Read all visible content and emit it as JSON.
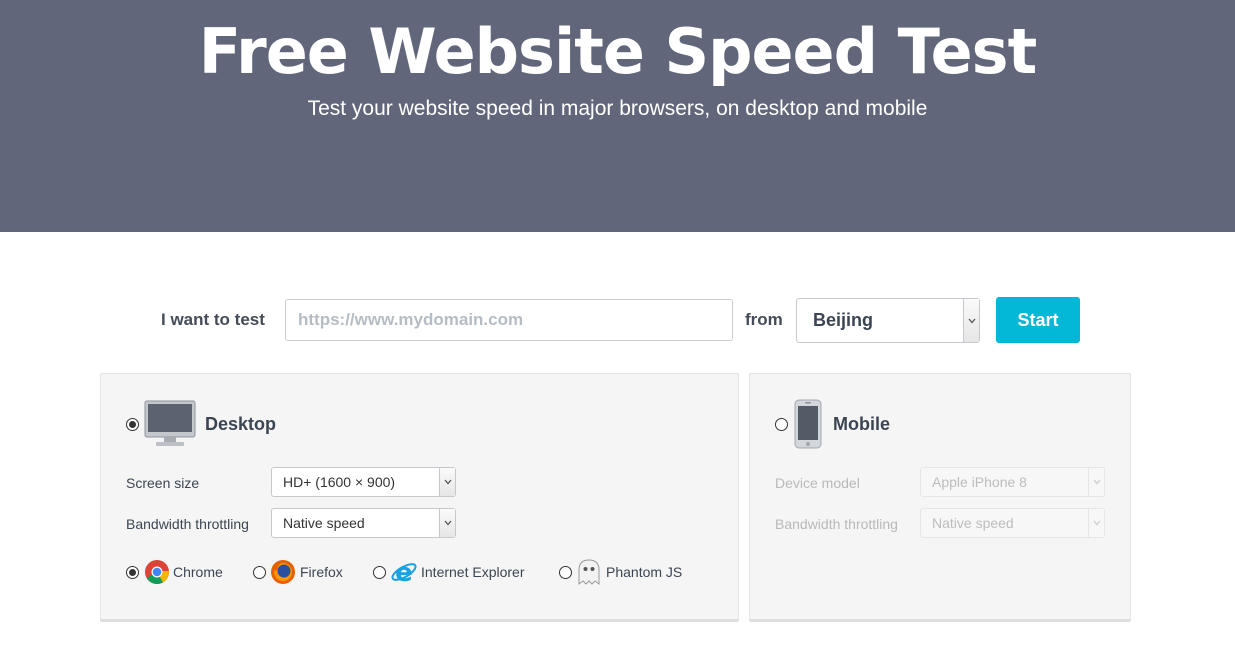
{
  "hero": {
    "title": "Free Website Speed Test",
    "subtitle": "Test your website speed in major browsers, on desktop and mobile"
  },
  "form": {
    "want_label": "I want to test",
    "url_placeholder": "https://www.mydomain.com",
    "url_value": "",
    "from_label": "from",
    "location": "Beijing",
    "start_label": "Start"
  },
  "desktop": {
    "title": "Desktop",
    "selected": true,
    "screen_size_label": "Screen size",
    "screen_size_value": "HD+ (1600 × 900)",
    "bandwidth_label": "Bandwidth throttling",
    "bandwidth_value": "Native speed",
    "browsers": [
      {
        "name": "Chrome",
        "icon": "chrome-icon",
        "selected": true
      },
      {
        "name": "Firefox",
        "icon": "firefox-icon",
        "selected": false
      },
      {
        "name": "Internet Explorer",
        "icon": "internet-explorer-icon",
        "selected": false
      },
      {
        "name": "Phantom JS",
        "icon": "phantomjs-icon",
        "selected": false
      }
    ]
  },
  "mobile": {
    "title": "Mobile",
    "selected": false,
    "device_label": "Device model",
    "device_value": "Apple iPhone 8",
    "bandwidth_label": "Bandwidth throttling",
    "bandwidth_value": "Native speed"
  },
  "colors": {
    "hero_bg": "#61667a",
    "accent": "#03b8d6",
    "panel_bg": "#f5f5f5"
  }
}
